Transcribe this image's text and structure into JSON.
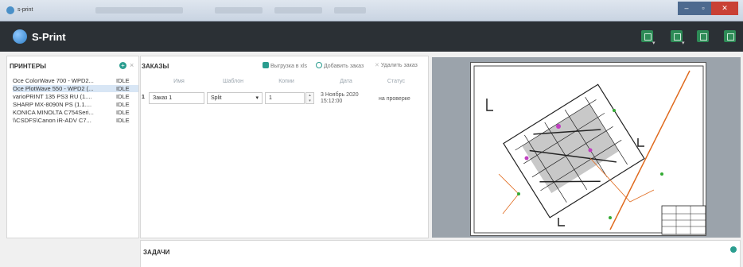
{
  "window": {
    "title": "s-print"
  },
  "app": {
    "name": "S-Print",
    "colors": {
      "accent": "#2e8b57",
      "teal": "#2a9d8f",
      "dark": "#2b3035",
      "close": "#c94135"
    },
    "toolbar_icons": [
      "export-icon",
      "print-settings-icon",
      "print-icon",
      "save-icon"
    ]
  },
  "printers": {
    "title": "ПРИНТЕРЫ",
    "items": [
      {
        "name": "Oce ColorWave 700 - WPD2...",
        "status": "IDLE"
      },
      {
        "name": "Oce PlotWave 550 - WPD2 (...",
        "status": "IDLE"
      },
      {
        "name": "varioPRINT 135 PS3 RU (1....",
        "status": "IDLE"
      },
      {
        "name": "SHARP MX-8090N PS (1.1....",
        "status": "IDLE"
      },
      {
        "name": "KONICA MINOLTA C754Seri...",
        "status": "IDLE"
      },
      {
        "name": "\\\\CSDFS\\Canon iR-ADV C7...",
        "status": "IDLE"
      }
    ]
  },
  "orders": {
    "title": "ЗАКАЗЫ",
    "actions": {
      "export": "Выгрузка в xls",
      "add": "Добавить заказ",
      "delete": "Удалить заказ"
    },
    "columns": [
      "Имя",
      "Шаблон",
      "Копии",
      "Дата",
      "Статус"
    ],
    "rows": [
      {
        "num": "1",
        "name": "Заказ 1",
        "template": "Split",
        "copies": "1",
        "date_line1": "3 Ноябрь 2020",
        "date_line2": "15:12:00",
        "status": "на проверке"
      }
    ]
  },
  "tasks": {
    "title": "ЗАДАЧИ"
  }
}
